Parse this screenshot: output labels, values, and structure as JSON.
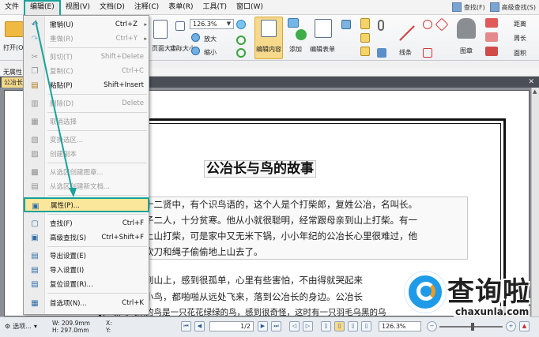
{
  "menubar": {
    "items": [
      "文件",
      "编辑(E)",
      "视图(V)",
      "文档(D)",
      "注释(C)",
      "表单(R)",
      "工具(T)",
      "窗口(W)"
    ],
    "find_label": "查找(F)",
    "advanced_find_label": "高级查找(S)"
  },
  "ribbon": {
    "open_label": "打开(O)",
    "zoom_value": "126.3%",
    "zoom_in_label": "放大",
    "zoom_out_label": "缩小",
    "actual_size_label": "实际大小",
    "page_size_label": "页面大小",
    "edit_content_label": "编辑内容",
    "add_label": "添加",
    "edit_form_label": "编辑表单",
    "line_label": "线条",
    "image_label": "图章",
    "distance_label": "距离",
    "perimeter_label": "周长",
    "area_label": "面积"
  },
  "status_row_label": "无属性",
  "doc_tab_label": "公冶长",
  "edit_menu": {
    "items": [
      {
        "label": "撤销(U)",
        "key": "Ctrl+Z",
        "disabled": false
      },
      {
        "label": "重做(R)",
        "key": "Ctrl+Y",
        "disabled": true
      },
      {
        "label": "剪切(T)",
        "key": "Shift+Delete",
        "disabled": true
      },
      {
        "label": "复制(C)",
        "key": "Ctrl+C",
        "disabled": true
      },
      {
        "label": "粘贴(P)",
        "key": "Shift+Insert",
        "disabled": false
      },
      {
        "label": "删除(D)",
        "key": "Delete",
        "disabled": true
      },
      {
        "label": "取消选择",
        "key": "",
        "disabled": true
      },
      {
        "label": "变换选区...",
        "key": "",
        "disabled": true
      },
      {
        "label": "创建副本",
        "key": "",
        "disabled": true
      },
      {
        "label": "从选区创建图章...",
        "key": "",
        "disabled": true
      },
      {
        "label": "从选区创建新文档...",
        "key": "",
        "disabled": true
      },
      {
        "label": "属性(P)...",
        "key": "",
        "disabled": false,
        "highlighted": true
      },
      {
        "label": "查找(F)",
        "key": "Ctrl+F",
        "disabled": false
      },
      {
        "label": "高级查找(S)",
        "key": "Ctrl+Shift+F",
        "disabled": false
      },
      {
        "label": "导出设置(E)",
        "key": "",
        "disabled": false
      },
      {
        "label": "导入设置(I)",
        "key": "",
        "disabled": false
      },
      {
        "label": "复位设置(R)...",
        "key": "",
        "disabled": false
      },
      {
        "label": "首选项(N)...",
        "key": "Ctrl+K",
        "disabled": false
      }
    ]
  },
  "document": {
    "title": "公冶长与鸟的故事",
    "lines": [
      "十二贤中，有个识鸟语的，这个人是个打柴郎，复姓公冶，名叫长。",
      "子二人，十分贫寒。他从小就很聪明，经常跟母亲到山上打柴。有一",
      "上山打柴，可是家中又无米下锅，小小年纪的公冶长心里很难过，他",
      "砍刀和绳子偷偷地上山去了。",
      "到山上，感到很孤单，心里有些害怕，不由得就哭起来",
      "小鸟，都啪啪从远处飞来，落到公冶长的身边。公冶长",
      "噪鸟飞来的鸟是一只花花绿绿的鸟，感到很奇怪，这时有一只羽毛乌黑的乌"
    ]
  },
  "statusbar": {
    "select_label": "选项...",
    "width_label": "W: 209.9mm",
    "height_label": "H: 297.0mm",
    "x_label": "X:",
    "y_label": "Y:",
    "page_value": "1/2",
    "zoom_value": "126.3%"
  },
  "watermark": {
    "text": "查询啦",
    "url": "chaxunla.com"
  },
  "colors": {
    "highlight_border": "#19a39a",
    "highlight_fill": "#fbe79b",
    "accent_blue": "#1e9be8"
  }
}
